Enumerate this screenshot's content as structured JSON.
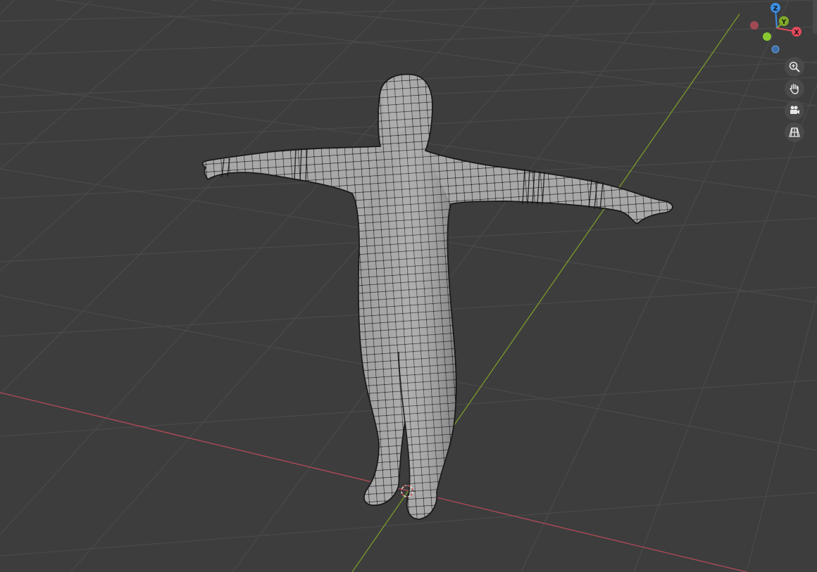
{
  "viewport": {
    "background": "#3d3d3d",
    "grid_color": "#484848",
    "x_axis_color": "#b34a56",
    "y_axis_color": "#7a9a2a",
    "mesh_fill": "#a6a6a6",
    "mesh_wire": "#1e1e1e"
  },
  "gizmo": {
    "z_label": "Z",
    "y_label": "Y",
    "x_label": "X",
    "x_color": "#e24a5e",
    "y_color": "#7faa2a",
    "z_color": "#3b8fe5",
    "neg_x_color": "#a04a55",
    "neg_y_color": "#8ac830",
    "neg_z_color": "#3d6ea8"
  },
  "nav_buttons": [
    {
      "name": "zoom-icon"
    },
    {
      "name": "pan-hand-icon"
    },
    {
      "name": "camera-view-icon"
    },
    {
      "name": "perspective-grid-icon"
    }
  ],
  "object": {
    "type": "mesh",
    "description_name": "humanoid-tpose-mesh"
  }
}
